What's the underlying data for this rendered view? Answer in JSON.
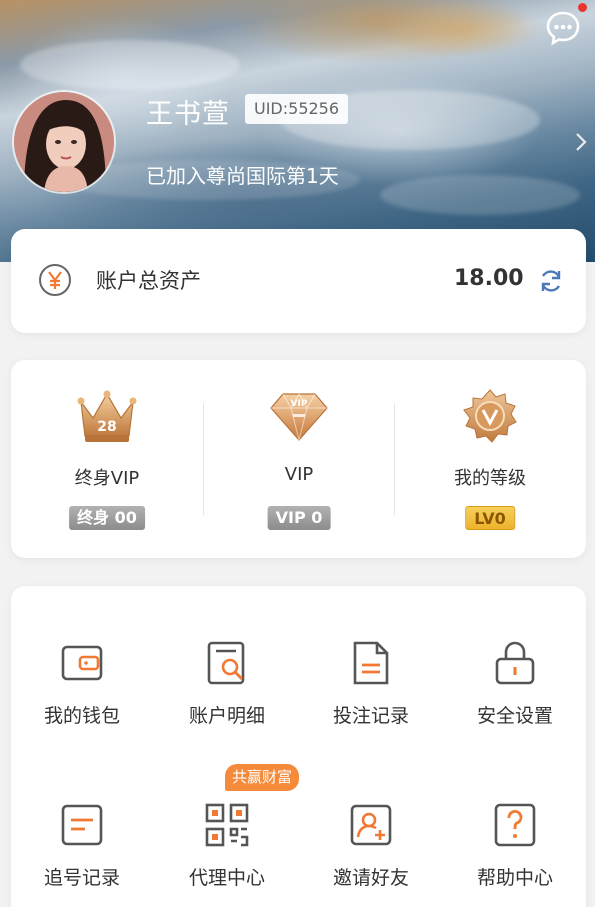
{
  "profile": {
    "name": "王书萱",
    "uid": "UID:55256",
    "joined": "已加入尊尚国际第1天"
  },
  "asset": {
    "label": "账户总资产",
    "value": "18.00"
  },
  "vip": [
    {
      "label": "终身VIP",
      "badge": "终身 00",
      "icon": "crown-icon"
    },
    {
      "label": "VIP",
      "badge": "VIP 0",
      "icon": "vip-diamond-icon"
    },
    {
      "label": "我的等级",
      "badge": "LV0",
      "icon": "level-medal-icon"
    }
  ],
  "crown_number": "28",
  "menu": [
    {
      "label": "我的钱包",
      "icon": "wallet-icon"
    },
    {
      "label": "账户明细",
      "icon": "account-detail-icon"
    },
    {
      "label": "投注记录",
      "icon": "bet-record-icon"
    },
    {
      "label": "安全设置",
      "icon": "lock-icon"
    },
    {
      "label": "追号记录",
      "icon": "chase-record-icon"
    },
    {
      "label": "代理中心",
      "icon": "qrcode-icon"
    },
    {
      "label": "邀请好友",
      "icon": "invite-friend-icon"
    },
    {
      "label": "帮助中心",
      "icon": "help-icon"
    }
  ],
  "promo_badge": "共赢财富",
  "colors": {
    "accent": "#f07a34",
    "notification_dot": "#e8332e",
    "gold_badge": "#eeb22a",
    "gray_badge": "#8c8c8c"
  }
}
